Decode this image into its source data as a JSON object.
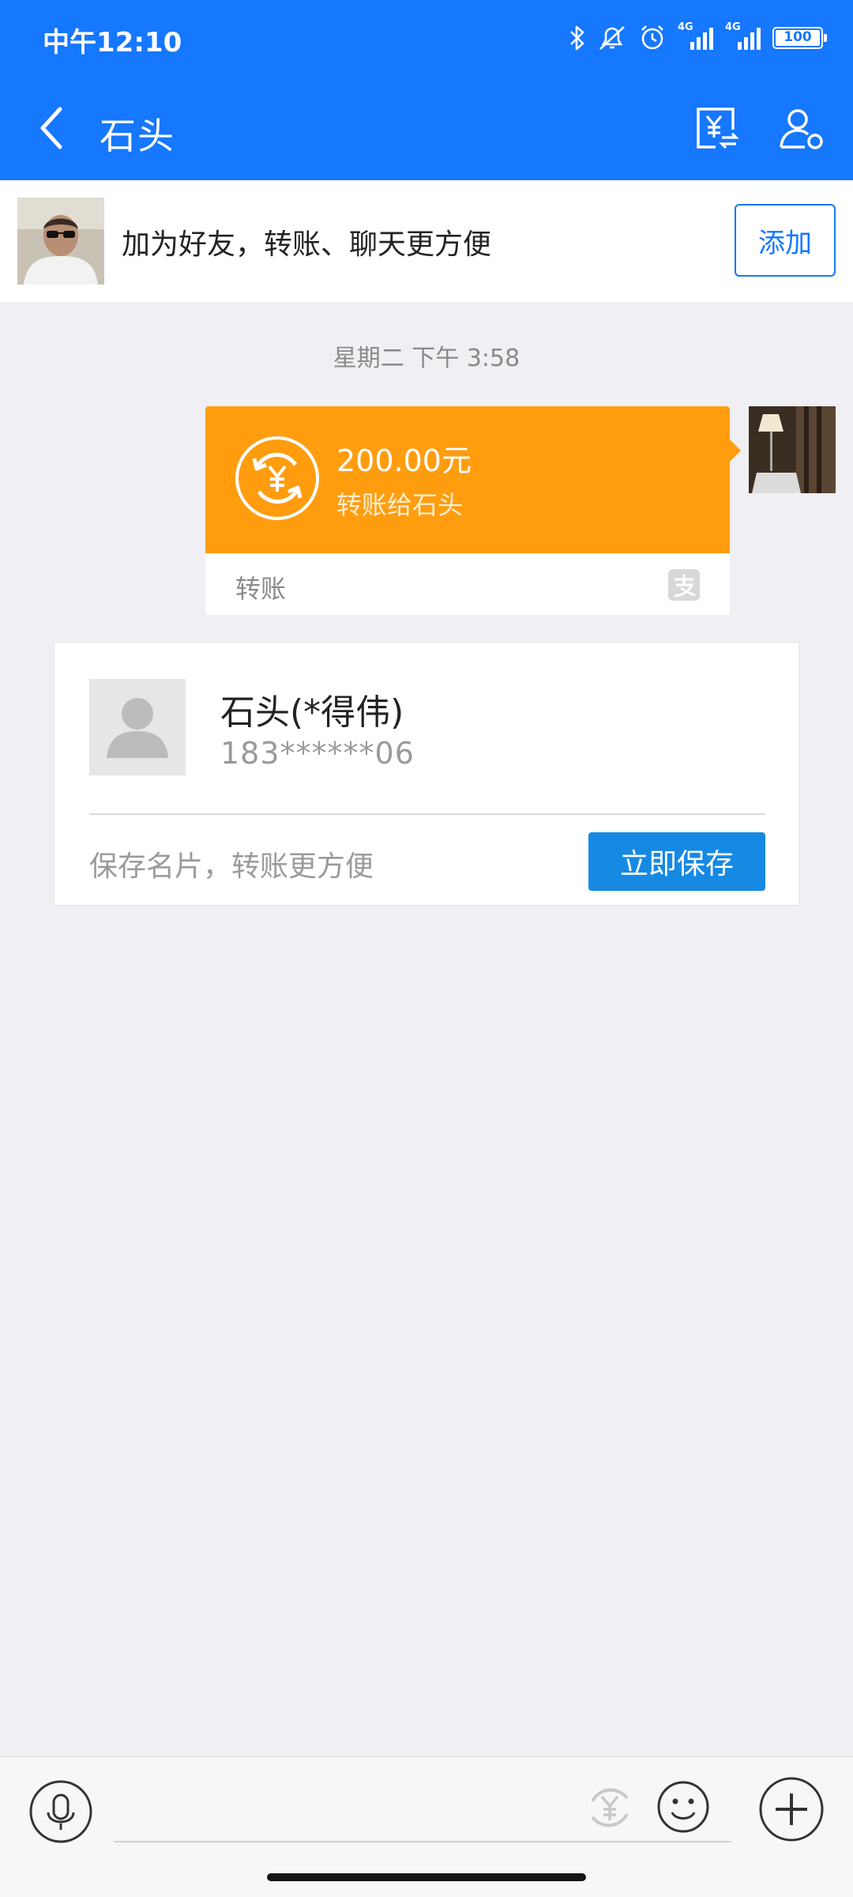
{
  "status_bar": {
    "time": "中午12:10",
    "network_1": "4G",
    "network_2": "4G",
    "battery": "100"
  },
  "nav": {
    "title": "石头",
    "icons": [
      "back-arrow-icon",
      "yen-transfer-icon",
      "profile-settings-icon"
    ]
  },
  "banner": {
    "text": "加为好友，转账、聊天更方便",
    "add_label": "添加"
  },
  "chat": {
    "timestamp": "星期二 下午 3:58",
    "transfer": {
      "amount": "200.00元",
      "description": "转账给石头",
      "label": "转账"
    },
    "contact_card": {
      "name": "石头(*得伟)",
      "phone": "183******06",
      "hint": "保存名片，转账更方便",
      "save_label": "立即保存"
    }
  },
  "input_bar": {
    "placeholder": "",
    "icons": [
      "microphone-icon",
      "yen-icon",
      "smiley-icon",
      "plus-icon"
    ]
  },
  "colors": {
    "header": "#1677ff",
    "transfer": "#ff9d0f",
    "save_button": "#1689e3",
    "background": "#f0eff3"
  }
}
